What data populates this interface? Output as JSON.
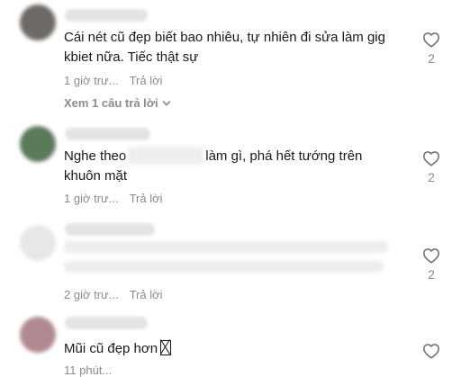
{
  "comments": [
    {
      "text": "Cái nét cũ đẹp biết bao nhiêu, tự nhiên đi sửa làm gig kbiet nữa. Tiếc thật sự",
      "time": "1 giờ trư...",
      "reply_label": "Trả lời",
      "view_replies": "Xem 1 câu trả lời",
      "likes": "2",
      "avatar_color": "#6f6a66"
    },
    {
      "text_before": "Nghe theo",
      "text_after": "làm gì, phá hết tướng trên khuôn mặt",
      "time": "1 giờ trư...",
      "reply_label": "Trả lời",
      "likes": "2",
      "avatar_color": "#5b7a5a"
    },
    {
      "time": "2 giờ trư...",
      "reply_label": "Trả lời",
      "likes": "2",
      "avatar_color": "#e7e7ea"
    },
    {
      "text": "Mũi cũ đẹp hơn",
      "time": "11 phút...",
      "avatar_color": "#b08a90"
    }
  ]
}
